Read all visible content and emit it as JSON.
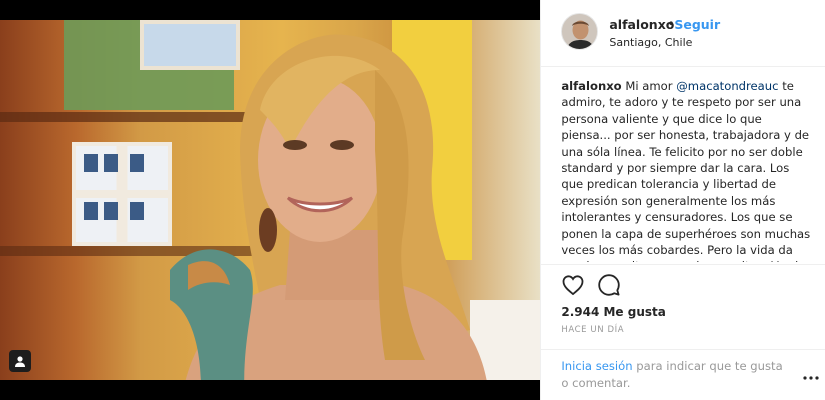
{
  "post": {
    "username": "alfalonxo",
    "separator": "•",
    "follow_label": "Seguir",
    "location": "Santiago, Chile"
  },
  "caption": {
    "username": "alfalonxo",
    "text_before_mention": "Mi amor",
    "mention": "@macatondreauc",
    "text_after_mention": "te admiro, te adoro y te respeto por ser una persona valiente y que dice lo que piensa... por ser honesta, trabajadora y de una sóla línea. Te felicito por no ser doble standard y por siempre dar la cara. Los que predican tolerancia y libertad de expresión son generalmente los más intolerantes y censuradores. Los que se ponen la capa de superhéroes son muchas veces los más cobardes. Pero la vida da muchas vueltas.... muchas vueltas. Me da una pena inmensa"
  },
  "stats": {
    "likes": "2.944 Me gusta",
    "time": "HACE UN DÍA"
  },
  "login": {
    "link": "Inicia sesión",
    "text": "para indicar que te gusta o comentar."
  },
  "icons": {
    "like": "heart-icon",
    "comment": "comment-icon",
    "media_badge": "user-tag-icon",
    "more": "more-options-icon"
  },
  "colors": {
    "link_blue": "#3897f0",
    "mention_blue": "#003569",
    "text": "#262626",
    "muted": "#999999"
  }
}
